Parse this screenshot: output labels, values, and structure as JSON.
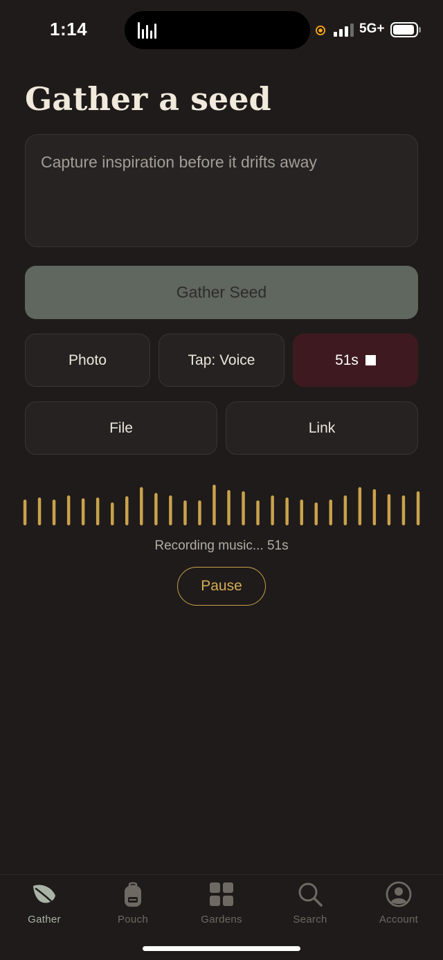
{
  "status_bar": {
    "time": "1:14",
    "network": "5G+",
    "recording_indicator_color": "#f2a31c"
  },
  "page": {
    "title": "Gather a seed"
  },
  "seed_input": {
    "placeholder": "Capture inspiration before it drifts away",
    "value": ""
  },
  "actions": {
    "gather_label": "Gather Seed",
    "photo_label": "Photo",
    "voice_label": "Tap: Voice",
    "recording_label": "51s",
    "file_label": "File",
    "link_label": "Link"
  },
  "recording": {
    "status": "Recording music... 51s",
    "pause_label": "Pause",
    "waveform_levels": [
      0.62,
      0.67,
      0.62,
      0.72,
      0.65,
      0.67,
      0.55,
      0.7,
      0.92,
      0.78,
      0.72,
      0.6,
      0.6,
      0.98,
      0.85,
      0.82,
      0.6,
      0.72,
      0.67,
      0.62,
      0.55,
      0.62,
      0.72,
      0.92,
      0.87,
      0.75,
      0.72,
      0.82
    ],
    "waveform_color": "#c9a24c"
  },
  "nav": {
    "items": [
      {
        "label": "Gather",
        "icon": "leaf-icon",
        "active": true
      },
      {
        "label": "Pouch",
        "icon": "backpack-icon",
        "active": false
      },
      {
        "label": "Gardens",
        "icon": "grid-icon",
        "active": false
      },
      {
        "label": "Search",
        "icon": "search-icon",
        "active": false
      },
      {
        "label": "Account",
        "icon": "account-icon",
        "active": false
      }
    ]
  },
  "colors": {
    "background": "#1f1b1a",
    "primary_button": "#5f675e",
    "record_button": "#3e1a20",
    "accent_gold": "#c9a24c",
    "active_nav": "#a9b4a7"
  }
}
